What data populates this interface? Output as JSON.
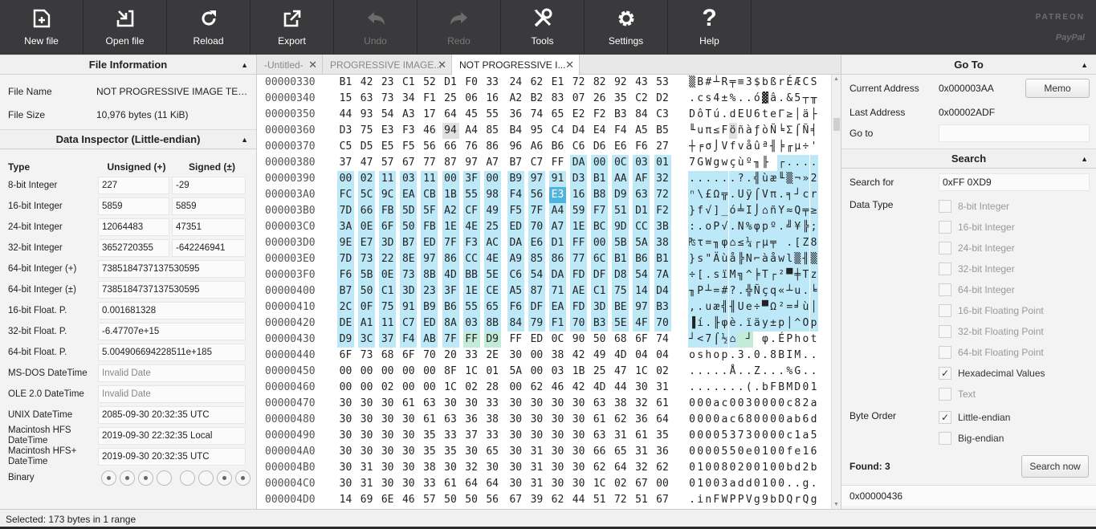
{
  "toolbar": {
    "buttons": [
      {
        "label": "New file",
        "icon": "new-file-icon",
        "enabled": true
      },
      {
        "label": "Open file",
        "icon": "open-file-icon",
        "enabled": true
      },
      {
        "label": "Reload",
        "icon": "reload-icon",
        "enabled": true
      },
      {
        "label": "Export",
        "icon": "export-icon",
        "enabled": true
      },
      {
        "label": "Undo",
        "icon": "undo-icon",
        "enabled": false
      },
      {
        "label": "Redo",
        "icon": "redo-icon",
        "enabled": false
      },
      {
        "label": "Tools",
        "icon": "tools-icon",
        "enabled": true
      },
      {
        "label": "Settings",
        "icon": "gear-icon",
        "enabled": true
      },
      {
        "label": "Help",
        "icon": "help-icon",
        "enabled": true
      }
    ],
    "patreon": "PATREON",
    "paypal": "PayPal"
  },
  "file_info": {
    "title": "File Information",
    "name_label": "File Name",
    "name_value": "NOT PROGRESSIVE IMAGE TEST.jpg",
    "size_label": "File Size",
    "size_value": "10,976 bytes (11 KiB)"
  },
  "inspector": {
    "title": "Data Inspector (Little-endian)",
    "col_type": "Type",
    "col_unsigned": "Unsigned (+)",
    "col_signed": "Signed (±)",
    "pairs": [
      {
        "label": "8-bit Integer",
        "u": "227",
        "s": "-29"
      },
      {
        "label": "16-bit Integer",
        "u": "5859",
        "s": "5859"
      },
      {
        "label": "24-bit Integer",
        "u": "12064483",
        "s": "47351"
      },
      {
        "label": "32-bit Integer",
        "u": "3652720355",
        "s": "-642246941"
      }
    ],
    "singles": [
      {
        "label": "64-bit Integer (+)",
        "value": "7385184737137530595",
        "dim": false
      },
      {
        "label": "64-bit Integer (±)",
        "value": "7385184737137530595",
        "dim": false
      },
      {
        "label": "16-bit Float. P.",
        "value": "0.001681328",
        "dim": false
      },
      {
        "label": "32-bit Float. P.",
        "value": "-6.47707e+15",
        "dim": false
      },
      {
        "label": "64-bit Float. P.",
        "value": "5.004906694228511e+185",
        "dim": false
      },
      {
        "label": "MS-DOS DateTime",
        "value": "Invalid Date",
        "dim": true
      },
      {
        "label": "OLE 2.0 DateTime",
        "value": "Invalid Date",
        "dim": true
      },
      {
        "label": "UNIX DateTime",
        "value": "2085-09-30 20:32:35 UTC",
        "dim": false
      },
      {
        "label": "Macintosh HFS DateTime",
        "value": "2019-09-30 22:32:35 Local",
        "dim": false
      },
      {
        "label": "Macintosh HFS+ DateTime",
        "value": "2019-09-30 20:32:35 UTC",
        "dim": false
      }
    ],
    "binary_label": "Binary",
    "binary_bits": [
      1,
      1,
      1,
      0,
      0,
      0,
      1,
      1
    ]
  },
  "tabs": [
    {
      "label": "-Untitled-",
      "active": false
    },
    {
      "label": "PROGRESSIVE IMAGE...",
      "active": false
    },
    {
      "label": "NOT PROGRESSIVE I...",
      "active": true
    }
  ],
  "hex": {
    "rows": [
      {
        "addr": "00000330",
        "bytes": "B1 42 23 C1 52 D1 F0 33 24 62 E1 72 82 92 43 53",
        "ascii": "▒B#┴R╤≡3$bßrÉÆCS"
      },
      {
        "addr": "00000340",
        "bytes": "15 63 73 34 F1 25 06 16 A2 B2 83 07 26 35 C2 D2",
        "ascii": ".cs4±%..ó▓â.&5┬╥"
      },
      {
        "addr": "00000350",
        "bytes": "44 93 54 A3 17 64 45 55 36 74 65 E2 F2 B3 84 C3",
        "ascii": "DôTú.dEU6teΓ≥│ä├"
      },
      {
        "addr": "00000360",
        "bytes": "D3 75 E3 F3 46 94 A4 85 B4 95 C4 D4 E4 F4 A5 B5",
        "ascii": "╙uπ≤FöñàƒòÑ╘Σ⌠Ñ╡"
      },
      {
        "addr": "00000370",
        "bytes": "C5 D5 E5 F5 56 66 76 86 96 A6 B6 C6 D6 E6 F6 27",
        "ascii": "┼╒σ⌡Vfvåûª╢╞╓µ÷'"
      },
      {
        "addr": "00000380",
        "bytes": "37 47 57 67 77 87 97 A7 B7 C7 FF DA 00 0C 03 01",
        "ascii": "7GWgwçùº╖╟ ┌...."
      },
      {
        "addr": "00000390",
        "bytes": "00 02 11 03 11 00 3F 00 B9 97 91 D3 B1 AA AF 32",
        "ascii": "......?.╣ùæ╙▒¬»2"
      },
      {
        "addr": "000003A0",
        "bytes": "FC 5C 9C EA CB 1B 55 98 F4 56 E3 16 B8 D9 63 72",
        "ascii": "ⁿ\\£Ω╦.Uÿ⌠Vπ.╕┘cr"
      },
      {
        "addr": "000003B0",
        "bytes": "7D 66 FB 5D 5F A2 CF 49 F5 7F A4 59 F7 51 D1 F2",
        "ascii": "}f√]_ó╧I⌡⌂ñY≈Q╤≥"
      },
      {
        "addr": "000003C0",
        "bytes": "3A 0E 6F 50 FB 1E 4E 25 ED 70 A7 1E BC 9D CC 3B",
        "ascii": ":.oP√.N%φpº.╝¥╠;"
      },
      {
        "addr": "000003D0",
        "bytes": "9E E7 3D B7 ED 7F F3 AC DA E6 D1 FF 00 5B 5A 38",
        "ascii": "₧τ=╖φ⌂≤¼┌µ╤ .[Z8"
      },
      {
        "addr": "000003E0",
        "bytes": "7D 73 22 8E 97 86 CC 4E A9 85 86 77 6C B1 B6 B1",
        "ascii": "}s\"Äùå╠N⌐àåwl▒╢▒"
      },
      {
        "addr": "000003F0",
        "bytes": "F6 5B 0E 73 8B 4D BB 5E C6 54 DA FD DF D8 54 7A",
        "ascii": "÷[.sïM╗^╞T┌²▀╪Tz"
      },
      {
        "addr": "00000400",
        "bytes": "B7 50 C1 3D 23 3F 1E CE A5 87 71 AE C1 75 14 D4",
        "ascii": "╖P┴=#?.╬Ñçq«┴u.╘"
      },
      {
        "addr": "00000410",
        "bytes": "2C 0F 75 91 B9 B6 55 65 F6 DF EA FD 3D BE 97 B3",
        "ascii": ",.uæ╣╢Ue÷▀Ω²=╛ù│"
      },
      {
        "addr": "00000420",
        "bytes": "DE A1 11 C7 ED 8A 03 8B 84 79 F1 70 B3 5E 4F 70",
        "ascii": "▐í.╟φè.ïäy±p│^Op"
      },
      {
        "addr": "00000430",
        "bytes": "D9 3C 37 F4 AB 7F FF D9 FF ED 0C 90 50 68 6F 74",
        "ascii": "┘<7⌠½⌂ ┘ φ.ÉPhot"
      },
      {
        "addr": "00000440",
        "bytes": "6F 73 68 6F 70 20 33 2E 30 00 38 42 49 4D 04 04",
        "ascii": "oshop.3.0.8BIM.."
      },
      {
        "addr": "00000450",
        "bytes": "00 00 00 00 00 8F 1C 01 5A 00 03 1B 25 47 1C 02",
        "ascii": ".....Å..Z...%G.."
      },
      {
        "addr": "00000460",
        "bytes": "00 00 02 00 00 1C 02 28 00 62 46 42 4D 44 30 31",
        "ascii": ".......(.bFBMD01"
      },
      {
        "addr": "00000470",
        "bytes": "30 30 30 61 63 30 30 33 30 30 30 30 63 38 32 61",
        "ascii": "000ac0030000c82a"
      },
      {
        "addr": "00000480",
        "bytes": "30 30 30 30 61 63 36 38 30 30 30 30 61 62 36 64",
        "ascii": "0000ac680000ab6d"
      },
      {
        "addr": "00000490",
        "bytes": "30 30 30 30 35 33 37 33 30 30 30 30 63 31 61 35",
        "ascii": "000053730000c1a5"
      },
      {
        "addr": "000004A0",
        "bytes": "30 30 30 30 35 35 30 65 30 31 30 30 66 65 31 36",
        "ascii": "0000550e0100fe16"
      },
      {
        "addr": "000004B0",
        "bytes": "30 31 30 30 38 30 32 30 30 31 30 30 62 64 32 62",
        "ascii": "010080200100bd2b"
      },
      {
        "addr": "000004C0",
        "bytes": "30 31 30 30 33 61 64 64 30 31 30 30 1C 02 67 00",
        "ascii": "01003add0100..g."
      },
      {
        "addr": "000004D0",
        "bytes": "14 69 6E 46 57 50 50 56 67 39 62 44 51 72 51 67",
        "ascii": ".inFWPPVg9bDQrQg"
      }
    ]
  },
  "goto": {
    "title": "Go To",
    "current_label": "Current Address",
    "current_value": "0x000003AA",
    "memo_label": "Memo",
    "last_label": "Last Address",
    "last_value": "0x00002ADF",
    "goto_label": "Go to",
    "goto_value": ""
  },
  "search": {
    "title": "Search",
    "for_label": "Search for",
    "for_value": "0xFF 0XD9",
    "type_label": "Data Type",
    "types": [
      {
        "label": "8-bit Integer",
        "checked": false
      },
      {
        "label": "16-bit Integer",
        "checked": false
      },
      {
        "label": "24-bit Integer",
        "checked": false
      },
      {
        "label": "32-bit Integer",
        "checked": false
      },
      {
        "label": "64-bit Integer",
        "checked": false
      },
      {
        "label": "16-bit Floating Point",
        "checked": false
      },
      {
        "label": "32-bit Floating Point",
        "checked": false
      },
      {
        "label": "64-bit Floating Point",
        "checked": false
      },
      {
        "label": "Hexadecimal Values",
        "checked": true
      },
      {
        "label": "Text",
        "checked": false
      }
    ],
    "order_label": "Byte Order",
    "orders": [
      {
        "label": "Little-endian",
        "checked": true
      },
      {
        "label": "Big-endian",
        "checked": false
      }
    ],
    "found_label": "Found: 3",
    "search_btn": "Search now",
    "result": "0x00000436"
  },
  "status": "Selected: 173 bytes in 1 range"
}
